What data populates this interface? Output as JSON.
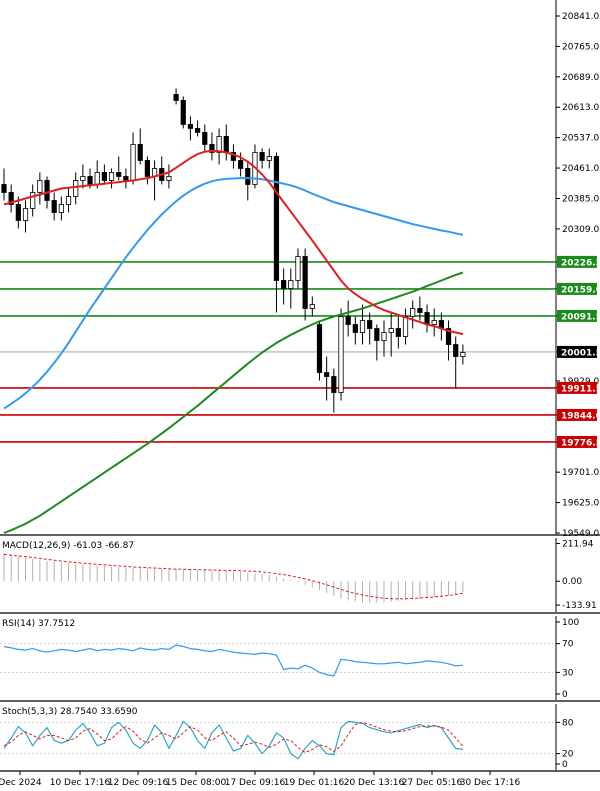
{
  "chart_data": {
    "type": "candlestick",
    "colors": {
      "bull": "#2a8a2a",
      "bear": "#d62020",
      "wick": "#000000",
      "ma_fast": "#e02020",
      "ma_mid": "#3399ee",
      "ma_slow": "#1f8a1f",
      "support": "#cc0000",
      "resistance": "#1a8a1a",
      "macd_signal": "#e02020",
      "macd_hist": "#b0b0b0",
      "rsi": "#3399ee",
      "stoch_main": "#2aa7c9",
      "stoch_signal": "#e02020",
      "price_tag": "#000000"
    },
    "main": {
      "y_ticks": [
        "20841.0",
        "20765.0",
        "20689.0",
        "20613.0",
        "20537.0",
        "20461.0",
        "20385.0",
        "20309.0",
        "20226.5",
        "20159.0",
        "20091.5",
        "20001.5",
        "19929.0",
        "19911.5",
        "19844.0",
        "19776.5",
        "19701.0",
        "19625.0",
        "19549.0"
      ],
      "ylim": [
        19549,
        20841
      ],
      "current_price": "20001.5",
      "support_levels": [
        "19911.5",
        "19844.0",
        "19776.5"
      ],
      "resistance_levels": [
        "20226.5",
        "20159.0",
        "20091.5"
      ],
      "candles": [
        [
          20420,
          20460,
          20380,
          20400
        ],
        [
          20400,
          20420,
          20350,
          20370
        ],
        [
          20370,
          20390,
          20310,
          20330
        ],
        [
          20330,
          20380,
          20300,
          20360
        ],
        [
          20360,
          20420,
          20340,
          20400
        ],
        [
          20400,
          20450,
          20370,
          20430
        ],
        [
          20430,
          20440,
          20360,
          20380
        ],
        [
          20380,
          20400,
          20330,
          20350
        ],
        [
          20350,
          20390,
          20330,
          20370
        ],
        [
          20370,
          20410,
          20350,
          20390
        ],
        [
          20390,
          20450,
          20370,
          20430
        ],
        [
          20430,
          20470,
          20410,
          20440
        ],
        [
          20440,
          20460,
          20410,
          20420
        ],
        [
          20420,
          20480,
          20410,
          20450
        ],
        [
          20450,
          20470,
          20420,
          20430
        ],
        [
          20430,
          20460,
          20410,
          20450
        ],
        [
          20450,
          20490,
          20430,
          20440
        ],
        [
          20440,
          20460,
          20410,
          20430
        ],
        [
          20430,
          20550,
          20420,
          20520
        ],
        [
          20520,
          20560,
          20470,
          20480
        ],
        [
          20480,
          20490,
          20420,
          20440
        ],
        [
          20440,
          20480,
          20380,
          20460
        ],
        [
          20460,
          20490,
          20420,
          20430
        ],
        [
          20430,
          20470,
          20410,
          20440
        ],
        [
          20645,
          20660,
          20620,
          20630
        ],
        [
          20630,
          20640,
          20560,
          20570
        ],
        [
          20570,
          20590,
          20530,
          20560
        ],
        [
          20560,
          20580,
          20540,
          20550
        ],
        [
          20550,
          20570,
          20500,
          20520
        ],
        [
          20520,
          20550,
          20480,
          20500
        ],
        [
          20500,
          20560,
          20470,
          20540
        ],
        [
          20540,
          20570,
          20480,
          20500
        ],
        [
          20500,
          20520,
          20460,
          20480
        ],
        [
          20480,
          20500,
          20440,
          20460
        ],
        [
          20460,
          20480,
          20380,
          20420
        ],
        [
          20420,
          20520,
          20410,
          20500
        ],
        [
          20500,
          20510,
          20460,
          20480
        ],
        [
          20480,
          20510,
          20460,
          20490
        ],
        [
          20490,
          20500,
          20100,
          20180
        ],
        [
          20180,
          20210,
          20120,
          20160
        ],
        [
          20160,
          20210,
          20110,
          20180
        ],
        [
          20180,
          20260,
          20160,
          20240
        ],
        [
          20240,
          20260,
          20080,
          20110
        ],
        [
          20110,
          20140,
          20090,
          20120
        ],
        [
          20070,
          20080,
          19930,
          19950
        ],
        [
          19950,
          19990,
          19880,
          19940
        ],
        [
          19940,
          19960,
          19850,
          19900
        ],
        [
          19900,
          20110,
          19880,
          20090
        ],
        [
          20090,
          20130,
          20040,
          20070
        ],
        [
          20070,
          20090,
          20020,
          20050
        ],
        [
          20050,
          20120,
          20020,
          20080
        ],
        [
          20080,
          20100,
          20020,
          20060
        ],
        [
          20060,
          20070,
          19980,
          20030
        ],
        [
          20030,
          20080,
          19990,
          20050
        ],
        [
          20050,
          20100,
          19990,
          20060
        ],
        [
          20060,
          20090,
          20010,
          20040
        ],
        [
          20040,
          20110,
          20020,
          20090
        ],
        [
          20090,
          20130,
          20060,
          20110
        ],
        [
          20110,
          20140,
          20080,
          20100
        ],
        [
          20100,
          20120,
          20050,
          20070
        ],
        [
          20070,
          20110,
          20040,
          20080
        ],
        [
          20080,
          20100,
          20030,
          20060
        ],
        [
          20060,
          20080,
          19980,
          20020
        ],
        [
          20020,
          20040,
          19910,
          19990
        ],
        [
          19990,
          20020,
          19970,
          20000
        ]
      ],
      "ma_fast": [
        20370,
        20375,
        20380,
        20385,
        20390,
        20395,
        20400,
        20405,
        20410,
        20412,
        20414,
        20416,
        20418,
        20420,
        20422,
        20424,
        20426,
        20428,
        20430,
        20433,
        20436,
        20440,
        20445,
        20450,
        20462,
        20474,
        20486,
        20496,
        20502,
        20504,
        20503,
        20500,
        20495,
        20488,
        20477,
        20463,
        20445,
        20425,
        20400,
        20376,
        20352,
        20328,
        20304,
        20280,
        20255,
        20230,
        20205,
        20180,
        20160,
        20146,
        20134,
        20124,
        20114,
        20106,
        20100,
        20094,
        20088,
        20082,
        20076,
        20070,
        20066,
        20060,
        20054,
        20050,
        20046
      ],
      "ma_mid": [
        19860,
        19872,
        19884,
        19898,
        19914,
        19932,
        19952,
        19974,
        19998,
        20024,
        20052,
        20080,
        20108,
        20134,
        20160,
        20186,
        20212,
        20238,
        20262,
        20284,
        20306,
        20326,
        20345,
        20362,
        20378,
        20392,
        20404,
        20414,
        20422,
        20428,
        20432,
        20434,
        20435,
        20436,
        20436,
        20435,
        20433,
        20430,
        20426,
        20422,
        20418,
        20412,
        20405,
        20397,
        20390,
        20383,
        20376,
        20371,
        20366,
        20361,
        20356,
        20351,
        20346,
        20341,
        20336,
        20331,
        20326,
        20321,
        20317,
        20313,
        20309,
        20305,
        20302,
        20298,
        20294
      ],
      "ma_slow": [
        19549,
        19556,
        19564,
        19572,
        19582,
        19592,
        19604,
        19616,
        19628,
        19640,
        19652,
        19664,
        19676,
        19688,
        19700,
        19712,
        19724,
        19736,
        19748,
        19760,
        19772,
        19785,
        19798,
        19811,
        19825,
        19839,
        19853,
        19867,
        19882,
        19897,
        19912,
        19927,
        19942,
        19957,
        19972,
        19986,
        20000,
        20012,
        20024,
        20034,
        20044,
        20053,
        20062,
        20070,
        20078,
        20084,
        20090,
        20095,
        20100,
        20105,
        20110,
        20116,
        20122,
        20128,
        20134,
        20140,
        20146,
        20152,
        20159,
        20166,
        20173,
        20180,
        20187,
        20194,
        20200
      ]
    },
    "macd": {
      "label": "MACD(12,26,9) -61.03 -66.87",
      "y_ticks": [
        "211.94",
        "0.00",
        "-133.91"
      ],
      "ylim": [
        -150,
        220
      ],
      "hist": [
        160,
        150,
        140,
        132,
        126,
        120,
        114,
        110,
        106,
        102,
        98,
        95,
        92,
        89,
        86,
        83,
        80,
        78,
        76,
        74,
        72,
        70,
        69,
        68,
        67,
        66,
        65,
        64,
        63,
        62,
        60,
        58,
        56,
        52,
        48,
        44,
        40,
        34,
        26,
        16,
        4,
        -8,
        -20,
        -34,
        -50,
        -66,
        -82,
        -98,
        -108,
        -114,
        -118,
        -120,
        -120,
        -118,
        -114,
        -110,
        -106,
        -102,
        -98,
        -94,
        -90,
        -86,
        -82,
        -76,
        -61
      ],
      "signal": [
        150,
        146,
        142,
        138,
        133,
        128,
        123,
        118,
        113,
        109,
        105,
        101,
        98,
        95,
        92,
        89,
        86,
        83,
        80,
        78,
        76,
        74,
        72,
        70,
        68,
        67,
        66,
        65,
        64,
        63,
        62,
        61,
        60,
        59,
        57,
        55,
        52,
        48,
        43,
        37,
        30,
        22,
        13,
        3,
        -8,
        -20,
        -33,
        -46,
        -58,
        -68,
        -77,
        -84,
        -90,
        -95,
        -98,
        -99,
        -98,
        -96,
        -94,
        -91,
        -88,
        -84,
        -80,
        -75,
        -67
      ]
    },
    "rsi": {
      "label": "RSI(14) 37.7512",
      "y_ticks": [
        "100",
        "70",
        "30",
        "0"
      ],
      "ylim": [
        0,
        100
      ],
      "values": [
        66,
        64,
        62,
        61,
        63,
        60,
        58,
        60,
        62,
        61,
        59,
        61,
        63,
        60,
        62,
        61,
        63,
        62,
        60,
        64,
        62,
        61,
        63,
        62,
        68,
        66,
        63,
        62,
        60,
        59,
        62,
        60,
        58,
        57,
        56,
        55,
        57,
        56,
        54,
        34,
        36,
        35,
        40,
        36,
        30,
        27,
        25,
        48,
        47,
        45,
        44,
        43,
        42,
        42,
        43,
        44,
        42,
        43,
        44,
        46,
        45,
        44,
        42,
        39,
        40
      ]
    },
    "stoch": {
      "label": "Stoch(5,3,3) 28.7540 33.6590",
      "y_ticks": [
        "80",
        "20",
        "0"
      ],
      "ylim": [
        0,
        100
      ],
      "main": [
        30,
        50,
        72,
        60,
        35,
        55,
        70,
        45,
        40,
        45,
        65,
        78,
        60,
        35,
        40,
        70,
        80,
        65,
        40,
        30,
        45,
        75,
        60,
        30,
        55,
        82,
        70,
        45,
        30,
        60,
        75,
        50,
        25,
        30,
        55,
        40,
        20,
        35,
        60,
        50,
        20,
        10,
        30,
        45,
        35,
        20,
        18,
        70,
        82,
        80,
        78,
        70,
        66,
        62,
        60,
        64,
        68,
        72,
        76,
        70,
        74,
        70,
        50,
        30,
        28
      ],
      "signal": [
        35,
        42,
        55,
        62,
        55,
        48,
        55,
        55,
        50,
        45,
        50,
        63,
        68,
        58,
        45,
        48,
        62,
        72,
        63,
        48,
        40,
        50,
        60,
        55,
        48,
        60,
        72,
        65,
        50,
        45,
        55,
        62,
        50,
        35,
        38,
        42,
        38,
        32,
        38,
        48,
        45,
        32,
        22,
        28,
        37,
        33,
        24,
        35,
        57,
        76,
        80,
        76,
        71,
        66,
        63,
        62,
        64,
        68,
        72,
        73,
        73,
        71,
        65,
        50,
        34
      ]
    },
    "x_ticks": [
      "Dec 2024",
      "10 Dec 17:16",
      "12 Dec 09:16",
      "15 Dec 08:00",
      "17 Dec 09:16",
      "19 Dec 01:16",
      "20 Dec 13:16",
      "27 Dec 05:16",
      "30 Dec 17:16"
    ]
  }
}
